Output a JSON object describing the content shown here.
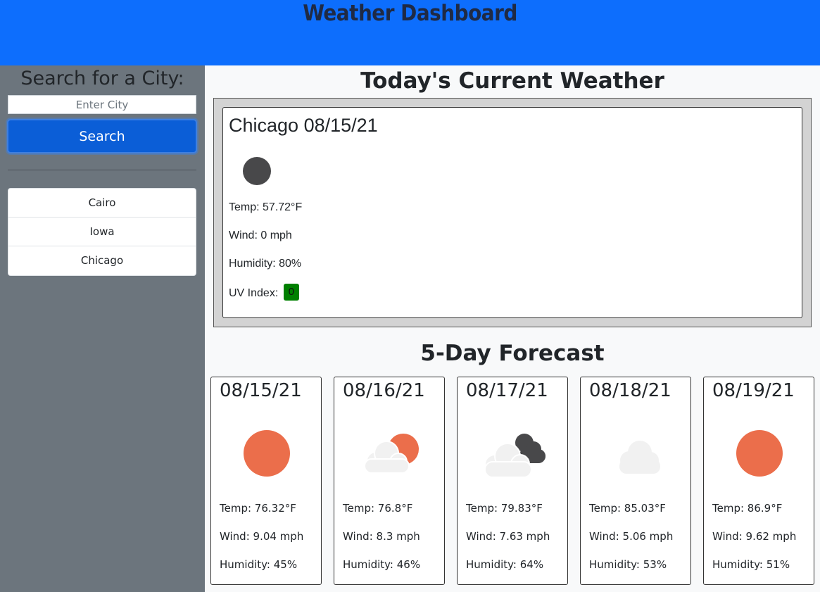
{
  "header": {
    "title": "Weather Dashboard"
  },
  "sidebar": {
    "heading": "Search for a City:",
    "input_placeholder": "Enter City",
    "input_value": "",
    "search_label": "Search",
    "history": [
      "Cairo",
      "Iowa",
      "Chicago"
    ]
  },
  "main": {
    "today_title": "Today's Current Weather",
    "forecast_title": "5-Day Forecast"
  },
  "current": {
    "heading": "Chicago 08/15/21",
    "icon": "moon-night-icon",
    "temp": "Temp: 57.72°F",
    "wind": "Wind: 0 mph",
    "humidity": "Humidity: 80%",
    "uv_label": "UV Index:",
    "uv_value": "0"
  },
  "forecast": [
    {
      "date": "08/15/21",
      "icon": "sun",
      "temp": "Temp: 76.32°F",
      "wind": "Wind: 9.04 mph",
      "humidity": "Humidity: 45%"
    },
    {
      "date": "08/16/21",
      "icon": "partly-cloudy",
      "temp": "Temp: 76.8°F",
      "wind": "Wind: 8.3 mph",
      "humidity": "Humidity: 46%"
    },
    {
      "date": "08/17/21",
      "icon": "broken-clouds",
      "temp": "Temp: 79.83°F",
      "wind": "Wind: 7.63 mph",
      "humidity": "Humidity: 64%"
    },
    {
      "date": "08/18/21",
      "icon": "cloud",
      "temp": "Temp: 85.03°F",
      "wind": "Wind: 5.06 mph",
      "humidity": "Humidity: 53%"
    },
    {
      "date": "08/19/21",
      "icon": "sun",
      "temp": "Temp: 86.9°F",
      "wind": "Wind: 9.62 mph",
      "humidity": "Humidity: 51%"
    }
  ],
  "colors": {
    "header": "#0d6efd",
    "sidebar": "#6c757d",
    "button": "#0b5ed7",
    "sun": "#eb6e4b",
    "cloud_light": "#f1f1f1",
    "cloud_dark": "#48484a",
    "uv_low": "#008000"
  }
}
